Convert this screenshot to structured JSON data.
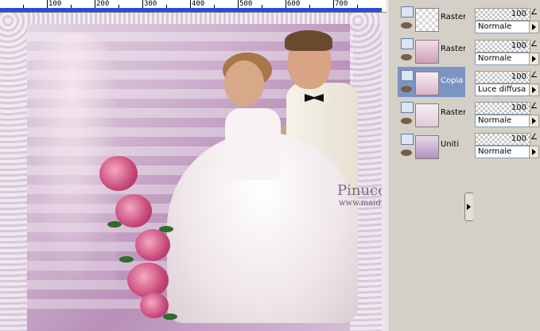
{
  "ruler": {
    "labels": [
      "100",
      "200",
      "300",
      "400",
      "500",
      "600",
      "700"
    ]
  },
  "image": {
    "watermark_name": "Pinuccia",
    "watermark_url": "www.maidiregrafica.eu"
  },
  "layers": [
    {
      "name": "Raster",
      "selected": false
    },
    {
      "name": "Raster",
      "selected": false
    },
    {
      "name": "Copia",
      "selected": true
    },
    {
      "name": "Raster",
      "selected": false
    },
    {
      "name": "Uniti",
      "selected": false
    }
  ],
  "properties": [
    {
      "opacity": "100",
      "blend": "Normale"
    },
    {
      "opacity": "100",
      "blend": "Normale"
    },
    {
      "opacity": "100",
      "blend": "Luce diffusa"
    },
    {
      "opacity": "100",
      "blend": "Normale"
    },
    {
      "opacity": "100",
      "blend": "Normale"
    }
  ],
  "colors": {
    "selected_row": "#7b94c4",
    "ruler_bar": "#2a4bd8"
  },
  "icons": [
    "layer-visibility-icon",
    "eye-icon",
    "brush-icon",
    "collapse-arrow-icon",
    "dropdown-arrow-icon"
  ]
}
